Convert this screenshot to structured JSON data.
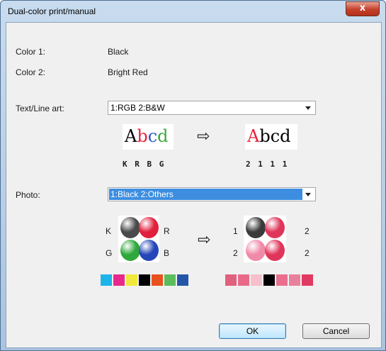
{
  "window": {
    "title": "Dual-color print/manual",
    "close_glyph": "x"
  },
  "color1": {
    "label": "Color 1:",
    "value": "Black"
  },
  "color2": {
    "label": "Color 2:",
    "value": "Bright Red"
  },
  "text_line_art": {
    "label": "Text/Line art:",
    "selected": "1:RGB 2:B&W",
    "before_text": [
      "A",
      "b",
      "c",
      "d"
    ],
    "before_colors": [
      "#000000",
      "#e8223a",
      "#2a55c8",
      "#3aa83a"
    ],
    "before_codes": "K R B G",
    "after_text": [
      "A",
      "b",
      "c",
      "d"
    ],
    "after_colors": [
      "#e8223a",
      "#000000",
      "#000000",
      "#000000"
    ],
    "after_codes": "2 1 1 1"
  },
  "photo": {
    "label": "Photo:",
    "selected": "1:Black 2:Others",
    "before_labels": {
      "top_left": "K",
      "top_right": "R",
      "bottom_left": "G",
      "bottom_right": "B"
    },
    "before_balls": [
      "#4a4a4a",
      "#e0203c",
      "#2ea83a",
      "#2546b8"
    ],
    "after_labels": {
      "top_left": "1",
      "top_right": "2",
      "bottom_left": "2",
      "bottom_right": "2"
    },
    "after_balls": [
      "#3a3a3a",
      "#e0355a",
      "#f08aa8",
      "#e0355a"
    ],
    "before_swatches": [
      "#1eb4e8",
      "#e8288c",
      "#f0e83a",
      "#000000",
      "#e8501e",
      "#5cbc5c",
      "#2456a8"
    ],
    "after_swatches": [
      "#e0607e",
      "#e86a88",
      "#f5c0cc",
      "#000000",
      "#e8708e",
      "#e8809c",
      "#e03a62"
    ]
  },
  "arrow_glyph": "⇨",
  "buttons": {
    "ok": "OK",
    "cancel": "Cancel"
  }
}
